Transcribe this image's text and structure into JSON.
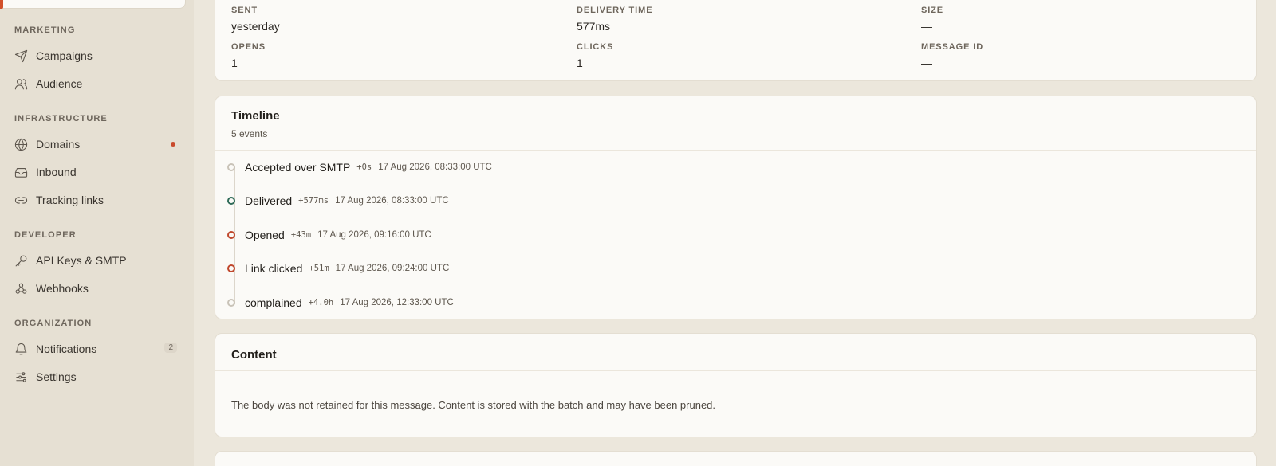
{
  "sidebar": {
    "sections": [
      {
        "label": "MARKETING",
        "items": [
          {
            "label": "Campaigns",
            "icon": "send-icon"
          },
          {
            "label": "Audience",
            "icon": "users-icon"
          }
        ]
      },
      {
        "label": "INFRASTRUCTURE",
        "items": [
          {
            "label": "Domains",
            "icon": "globe-icon"
          },
          {
            "label": "Inbound",
            "icon": "inbox-icon"
          },
          {
            "label": "Tracking links",
            "icon": "link-icon"
          }
        ]
      },
      {
        "label": "DEVELOPER",
        "items": [
          {
            "label": "API Keys & SMTP",
            "icon": "key-icon"
          },
          {
            "label": "Webhooks",
            "icon": "webhook-icon"
          }
        ]
      },
      {
        "label": "ORGANIZATION",
        "items": [
          {
            "label": "Notifications",
            "icon": "bell-icon",
            "badge": "2"
          },
          {
            "label": "Settings",
            "icon": "sliders-icon"
          }
        ]
      }
    ],
    "status_dot_color": "#c94a2c"
  },
  "stats": {
    "sent_label": "SENT",
    "sent_value": "yesterday",
    "delivery_label": "DELIVERY TIME",
    "delivery_value": "577ms",
    "size_label": "SIZE",
    "size_value": "—",
    "opens_label": "OPENS",
    "opens_value": "1",
    "clicks_label": "CLICKS",
    "clicks_value": "1",
    "message_id_label": "MESSAGE ID",
    "message_id_value": "—"
  },
  "timeline": {
    "title": "Timeline",
    "subtitle": "5 events",
    "events": [
      {
        "name": "Accepted over SMTP",
        "offset": "+0s",
        "time": "17 Aug 2026, 08:33:00 UTC",
        "color": "#c9c3b8"
      },
      {
        "name": "Delivered",
        "offset": "+577ms",
        "time": "17 Aug 2026, 08:33:00 UTC",
        "color": "#2f6b58"
      },
      {
        "name": "Opened",
        "offset": "+43m",
        "time": "17 Aug 2026, 09:16:00 UTC",
        "color": "#c0472c"
      },
      {
        "name": "Link clicked",
        "offset": "+51m",
        "time": "17 Aug 2026, 09:24:00 UTC",
        "color": "#c0472c"
      },
      {
        "name": "complained",
        "offset": "+4.0h",
        "time": "17 Aug 2026, 12:33:00 UTC",
        "color": "#c9c3b8"
      }
    ]
  },
  "content": {
    "title": "Content",
    "body": "The body was not retained for this message. Content is stored with the batch and may have been pruned."
  }
}
